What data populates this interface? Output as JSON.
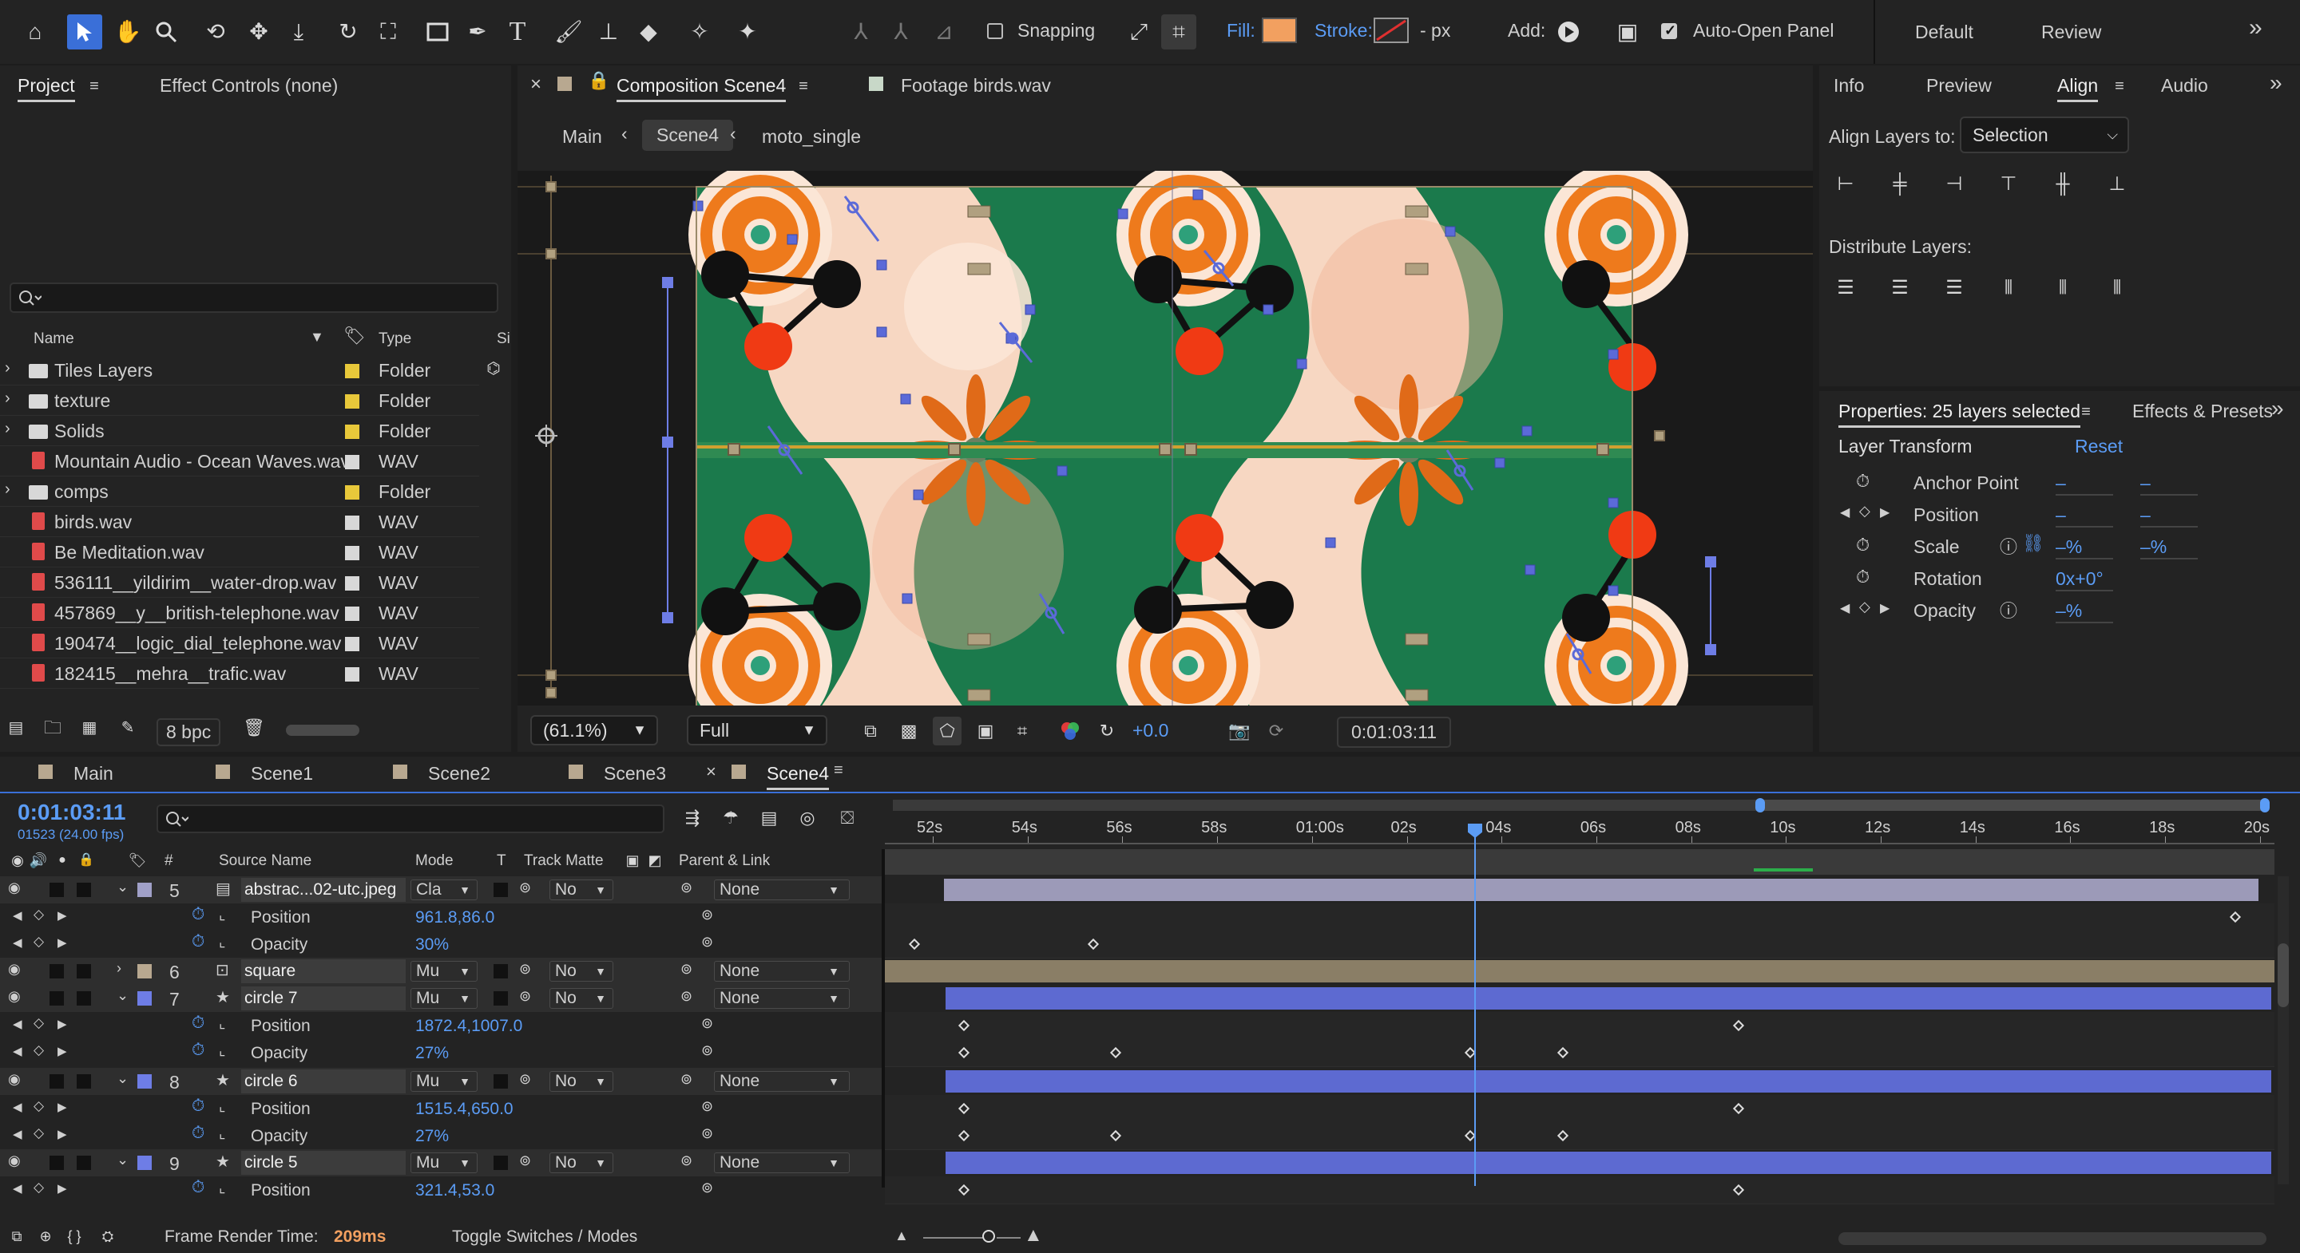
{
  "toolbar": {
    "snapping_label": "Snapping",
    "fill_label": "Fill:",
    "stroke_label": "Stroke:",
    "stroke_unit": "- px",
    "add_label": "Add:",
    "auto_open_label": "Auto-Open Panel",
    "workspaces": [
      "Default",
      "Review"
    ],
    "more": "»",
    "fill_color": "#f2a060",
    "accent_color": "#3a6fd8"
  },
  "project_panel": {
    "tabs": [
      "Project",
      "Effect Controls (none)"
    ],
    "search_placeholder": "",
    "col_name": "Name",
    "col_type": "Type",
    "col_size": "Si",
    "items": [
      {
        "name": "Tiles Layers",
        "type": "Folder",
        "kind": "folder"
      },
      {
        "name": "texture",
        "type": "Folder",
        "kind": "folder"
      },
      {
        "name": "Solids",
        "type": "Folder",
        "kind": "folder"
      },
      {
        "name": "Mountain Audio - Ocean Waves.wav",
        "type": "WAV",
        "kind": "audio"
      },
      {
        "name": "comps",
        "type": "Folder",
        "kind": "folder"
      },
      {
        "name": "birds.wav",
        "type": "WAV",
        "kind": "audio"
      },
      {
        "name": "Be Meditation.wav",
        "type": "WAV",
        "kind": "audio"
      },
      {
        "name": "536111__yildirim__water-drop.wav",
        "type": "WAV",
        "kind": "audio"
      },
      {
        "name": "457869__y__british-telephone.wav",
        "type": "WAV",
        "kind": "audio"
      },
      {
        "name": "190474__logic_dial_telephone.wav",
        "type": "WAV",
        "kind": "audio"
      },
      {
        "name": "182415__mehra__trafic.wav",
        "type": "WAV",
        "kind": "audio"
      }
    ],
    "bpc": "8 bpc"
  },
  "comp_panel": {
    "tab_close": "×",
    "tab_comp": "Composition Scene4",
    "tab_footage": "Footage birds.wav",
    "breadcrumbs": [
      "Main",
      "Scene4",
      "moto_single"
    ],
    "zoom": "(61.1%)",
    "resolution": "Full",
    "exposure": "+0.0",
    "timecode": "0:01:03:11"
  },
  "right_panel": {
    "tabs": [
      "Info",
      "Preview",
      "Align",
      "Audio"
    ],
    "align_layers_to_label": "Align Layers to:",
    "align_layers_to_value": "Selection",
    "distribute_label": "Distribute Layers:",
    "properties_title": "Properties: 25 layers selected",
    "effects_tab": "Effects & Presets",
    "layer_transform": "Layer Transform",
    "reset": "Reset",
    "props": [
      {
        "name": "Anchor Point",
        "v1": "–",
        "v2": "–"
      },
      {
        "name": "Position",
        "v1": "–",
        "v2": "–"
      },
      {
        "name": "Scale",
        "v1": "–%",
        "v2": "–%"
      },
      {
        "name": "Rotation",
        "v1": "0x+0°",
        "v2": ""
      },
      {
        "name": "Opacity",
        "v1": "–%",
        "v2": ""
      }
    ]
  },
  "timeline": {
    "tabs": [
      "Main",
      "Scene1",
      "Scene2",
      "Scene3",
      "Scene4"
    ],
    "current_time": "0:01:03:11",
    "frame_info": "01523 (24.00 fps)",
    "col_hash": "#",
    "col_source": "Source Name",
    "col_mode": "Mode",
    "col_t": "T",
    "col_track": "Track Matte",
    "col_parent": "Parent & Link",
    "ruler": [
      "52s",
      "54s",
      "56s",
      "58s",
      "01:00s",
      "02s",
      "04s",
      "06s",
      "08s",
      "10s",
      "12s",
      "14s",
      "16s",
      "18s",
      "20s"
    ],
    "rows": [
      {
        "kind": "layer",
        "num": "5",
        "name": "abstrac...02-utc.jpeg",
        "mode": "Cla",
        "track": "No",
        "parent": "None"
      },
      {
        "kind": "prop",
        "name": "Position",
        "value": "961.8,86.0"
      },
      {
        "kind": "prop",
        "name": "Opacity",
        "value": "30%"
      },
      {
        "kind": "layer",
        "num": "6",
        "name": "square",
        "mode": "Mu",
        "track": "No",
        "parent": "None"
      },
      {
        "kind": "layer",
        "num": "7",
        "name": "circle 7",
        "mode": "Mu",
        "track": "No",
        "parent": "None"
      },
      {
        "kind": "prop",
        "name": "Position",
        "value": "1872.4,1007.0"
      },
      {
        "kind": "prop",
        "name": "Opacity",
        "value": "27%"
      },
      {
        "kind": "layer",
        "num": "8",
        "name": "circle 6",
        "mode": "Mu",
        "track": "No",
        "parent": "None"
      },
      {
        "kind": "prop",
        "name": "Position",
        "value": "1515.4,650.0"
      },
      {
        "kind": "prop",
        "name": "Opacity",
        "value": "27%"
      },
      {
        "kind": "layer",
        "num": "9",
        "name": "circle 5",
        "mode": "Mu",
        "track": "No",
        "parent": "None"
      },
      {
        "kind": "prop",
        "name": "Position",
        "value": "321.4,53.0"
      }
    ],
    "frame_render_label": "Frame Render Time:",
    "frame_render_value": "209ms",
    "toggle_label": "Toggle Switches / Modes"
  }
}
